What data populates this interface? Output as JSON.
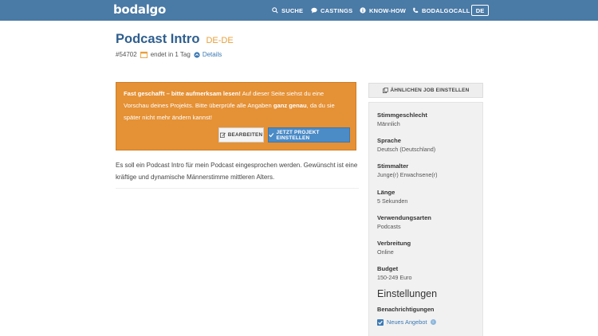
{
  "header": {
    "logo": "bodalgo",
    "nav": [
      {
        "label": "SUCHE",
        "icon": "search-icon"
      },
      {
        "label": "CASTINGS",
        "icon": "chat-icon"
      },
      {
        "label": "KNOW-HOW",
        "icon": "info-icon"
      },
      {
        "label": "BODALGOCALL",
        "icon": "phone-icon"
      }
    ],
    "language": "DE"
  },
  "job": {
    "title": "Podcast Intro",
    "lang_code": "DE-DE",
    "id": "#54702",
    "ends": "endet in 1 Tag",
    "details_link": "Details"
  },
  "alert": {
    "strong1": "Fast geschafft – bitte aufmerksam lesen!",
    "text1": " Auf dieser Seite siehst du eine Vorschau deines Projekts. Bitte überprüfe alle Angaben ",
    "strong2": "ganz genau",
    "text2": ", da du sie später nicht mehr ändern kannst!",
    "edit_label": "BEARBEITEN",
    "submit_label": "JETZT PROJEKT EINSTELLEN"
  },
  "description": "Es soll ein Podcast Intro für mein Podcast eingesprochen werden. Gewünscht ist eine kräftige und dynamische Männerstimme mittleren Alters.",
  "sidebar": {
    "similar_button": "ÄHNLICHEN JOB EINSTELLEN",
    "fields": [
      {
        "label": "Stimmgeschlecht",
        "value": "Männlich"
      },
      {
        "label": "Sprache",
        "value": "Deutsch (Deutschland)"
      },
      {
        "label": "Stimmalter",
        "value": "Junge(r) Erwachsene(r)"
      },
      {
        "label": "Länge",
        "value": "5 Sekunden"
      },
      {
        "label": "Verwendungsarten",
        "value": "Podcasts"
      },
      {
        "label": "Verbreitung",
        "value": "Online"
      },
      {
        "label": "Budget",
        "value": "150-249 Euro"
      }
    ],
    "settings_title": "Einstellungen",
    "notifications_label": "Benachrichtigungen",
    "checkbox_label": "Neues Angebot",
    "checkbox_checked": true
  },
  "colors": {
    "header_bg": "#4a7aa6",
    "title": "#2f5f8f",
    "accent_orange": "#e59135",
    "primary_button": "#4b8bc6"
  }
}
